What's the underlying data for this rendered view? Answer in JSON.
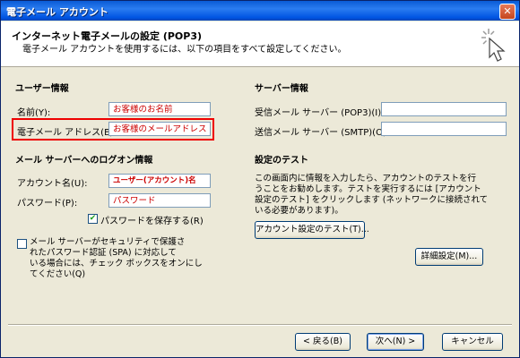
{
  "window": {
    "title": "電子メール アカウント",
    "close": "✕"
  },
  "header": {
    "title": "インターネット電子メールの設定 (POP3)",
    "description": "電子メール アカウントを使用するには、以下の項目をすべて設定してください。"
  },
  "user_info": {
    "title": "ユーザー情報",
    "name_label": "名前(Y):",
    "name_value": "お客様のお名前",
    "email_label": "電子メール アドレス(E):",
    "email_value": "お客様のメールアドレス"
  },
  "logon_info": {
    "title": "メール サーバーへのログオン情報",
    "account_label": "アカウント名(U):",
    "account_value": "ユーザー(アカウント)名",
    "password_label": "パスワード(P):",
    "password_value": "パスワード",
    "remember_label": "パスワードを保存する(R)",
    "remember_checked": "✔",
    "spa_line1": "メール サーバーがセキュリティで保護さ",
    "spa_line2": "れたパスワード認証 (SPA) に対応して",
    "spa_line3": "いる場合には、チェック ボックスをオンにし",
    "spa_line4": "てください(Q)"
  },
  "server_info": {
    "title": "サーバー情報",
    "incoming_label": "受信メール サーバー (POP3)(I):",
    "incoming_value": "",
    "outgoing_label": "送信メール サーバー (SMTP)(O):",
    "outgoing_value": ""
  },
  "test_settings": {
    "title": "設定のテスト",
    "desc_line1": "この画面内に情報を入力したら、アカウントのテストを行",
    "desc_line2": "うことをお勧めします。テストを実行するには [アカウント",
    "desc_line3": "設定のテスト] をクリックします (ネットワークに接続されて",
    "desc_line4": "いる必要があります)。",
    "test_button": "アカウント設定のテスト(T)...",
    "more_settings_button": "詳細設定(M)..."
  },
  "footer": {
    "back_button": "< 戻る(B)",
    "next_button": "次へ(N) >",
    "cancel_button": "キャンセル"
  },
  "colors": {
    "highlight": "#ee0000",
    "input_text": "#cc0000",
    "title_bar": "#0054e3"
  },
  "icons": {
    "close": "close-icon",
    "wizard": "wizard-cursor-icon"
  }
}
